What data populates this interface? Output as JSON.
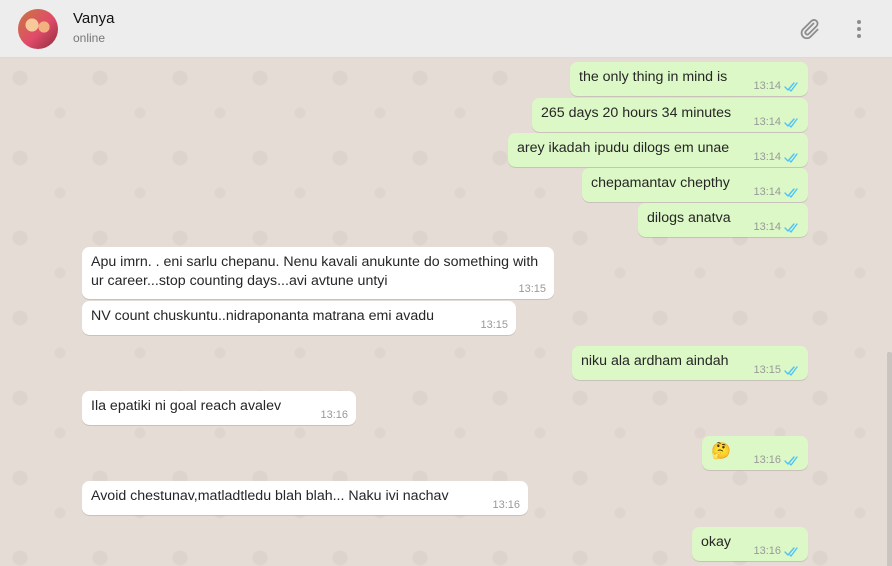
{
  "header": {
    "contact_name": "Vanya",
    "status": "online",
    "icons": {
      "attach": "paperclip-icon",
      "menu": "more-vertical-icon"
    }
  },
  "colors": {
    "outgoing_bubble": "#dcf8c6",
    "incoming_bubble": "#ffffff",
    "read_ticks": "#4fc3f7",
    "chat_background": "#e5ddd5"
  },
  "messages": [
    {
      "direction": "out",
      "text": "the only thing in mind is",
      "time": "13:14",
      "read": true
    },
    {
      "direction": "out",
      "text": "265 days 20 hours 34 minutes",
      "time": "13:14",
      "read": true
    },
    {
      "direction": "out",
      "text": "arey ikadah ipudu dilogs em unae",
      "time": "13:14",
      "read": true
    },
    {
      "direction": "out",
      "text": "chepamantav chepthy",
      "time": "13:14",
      "read": true
    },
    {
      "direction": "out",
      "text": "dilogs anatva",
      "time": "13:14",
      "read": true
    },
    {
      "direction": "in",
      "text": "Apu imrn. . eni sarlu chepanu.  Nenu kavali anukunte do something with ur career...stop counting days...avi avtune untyi",
      "time": "13:15"
    },
    {
      "direction": "in",
      "text": "NV count chuskuntu..nidraponanta matrana emi avadu",
      "time": "13:15"
    },
    {
      "direction": "out",
      "text": "niku ala ardham aindah",
      "time": "13:15",
      "read": true
    },
    {
      "direction": "in",
      "text": "Ila epatiki ni goal reach avalev",
      "time": "13:16"
    },
    {
      "direction": "out",
      "text": "🤔",
      "time": "13:16",
      "read": true
    },
    {
      "direction": "in",
      "text": "Avoid chestunav,matladtledu blah blah... Naku ivi nachav",
      "time": "13:16"
    },
    {
      "direction": "out",
      "text": "okay",
      "time": "13:16",
      "read": true
    }
  ]
}
